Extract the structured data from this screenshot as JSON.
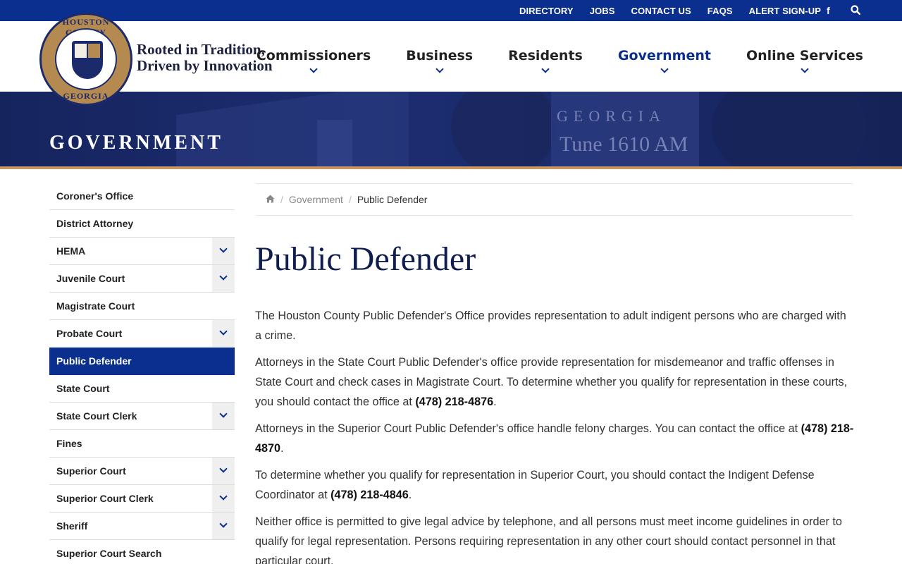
{
  "topbar": {
    "links": [
      "DIRECTORY",
      "JOBS",
      "CONTACT US",
      "FAQS",
      "ALERT SIGN-UP"
    ],
    "icons": [
      "facebook-icon",
      "search-icon"
    ]
  },
  "header": {
    "seal_top": "HOUSTON COUNTY",
    "seal_bottom": "GEORGIA",
    "tagline_line1": "Rooted in Tradition,",
    "tagline_line2": "Driven by Innovation"
  },
  "nav": {
    "items": [
      {
        "label": "Commissioners"
      },
      {
        "label": "Business"
      },
      {
        "label": "Residents"
      },
      {
        "label": "Government",
        "active": true
      },
      {
        "label": "Online Services"
      }
    ]
  },
  "hero": {
    "title": "GOVERNMENT",
    "sign_line1": "GEORGIA",
    "sign_line2": "Tune 1610 AM"
  },
  "sidebar": {
    "items": [
      {
        "label": "Coroner's Office",
        "expandable": false
      },
      {
        "label": "District Attorney",
        "expandable": false
      },
      {
        "label": "HEMA",
        "expandable": true
      },
      {
        "label": "Juvenile Court",
        "expandable": true
      },
      {
        "label": "Magistrate Court",
        "expandable": false
      },
      {
        "label": "Probate Court",
        "expandable": true
      },
      {
        "label": "Public Defender",
        "expandable": false,
        "active": true
      },
      {
        "label": "State Court",
        "expandable": false
      },
      {
        "label": "State Court Clerk",
        "expandable": true
      },
      {
        "label": "Fines",
        "expandable": false
      },
      {
        "label": "Superior Court",
        "expandable": true
      },
      {
        "label": "Superior Court Clerk",
        "expandable": true
      },
      {
        "label": "Sheriff",
        "expandable": true
      },
      {
        "label": "Superior Court Search",
        "expandable": false
      }
    ]
  },
  "breadcrumb": {
    "home_icon": "home-icon",
    "link": "Government",
    "current": "Public Defender"
  },
  "content": {
    "title": "Public Defender",
    "p1": "The Houston County Public Defender's Office provides representation to adult indigent persons who are charged with a crime.",
    "p2_text": "Attorneys in the State Court Public Defender's office provide representation for misdemeanor and traffic offenses in State Court and check cases in Magistrate Court. To determine whether you qualify for representation in these courts, you should contact the office at ",
    "p2_phone": "(478) 218-4876",
    "p3_text": "Attorneys in the Superior Court Public Defender's office handle felony charges. You can contact the office at ",
    "p3_phone": "(478) 218-4870",
    "p4_text": "To determine whether you qualify for representation in Superior Court, you should contact the Indigent Defense Coordinator at ",
    "p4_phone": "(478) 218-4846",
    "p5": "Neither office is permitted to give legal advice by telephone, and all persons must meet income guidelines in order to qualify for legal representation. Persons requiring representation in any other court should contact personnel in that particular court."
  },
  "colors": {
    "brand_blue": "#0b2f8f",
    "navy": "#0f1e4f",
    "gold": "#c9965f"
  }
}
